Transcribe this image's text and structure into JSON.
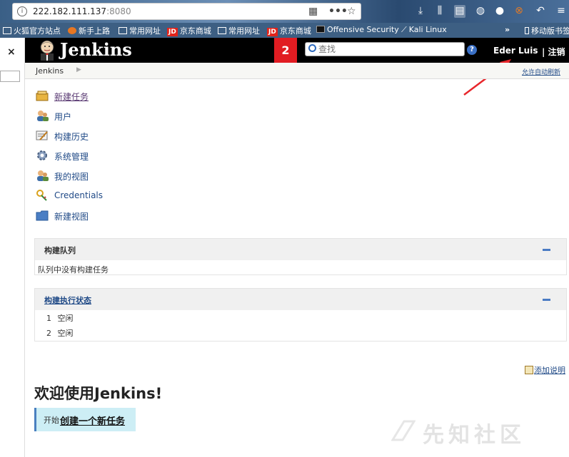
{
  "browser": {
    "url_host": "222.182.111.137",
    "url_port": ":8080",
    "bookmarks": [
      "火狐官方站点",
      "新手上路",
      "常用网址",
      "京东商城",
      "常用网址",
      "京东商城",
      "Offensive Security",
      "Kali Linux",
      "移动版书签"
    ],
    "jd_badge": "JD"
  },
  "sidebar": {
    "close_label": "×"
  },
  "header": {
    "title": "Jenkins",
    "notification_count": "2",
    "search_placeholder": "查找",
    "help_label": "?",
    "user_name": "Eder Luis",
    "logout_label": "| 注销"
  },
  "breadcrumb": {
    "root": "Jenkins",
    "auto_refresh": "允许自动刷新"
  },
  "tasks": [
    {
      "label": "新建任务",
      "icon": "new-item-icon"
    },
    {
      "label": "用户",
      "icon": "users-icon"
    },
    {
      "label": "构建历史",
      "icon": "build-history-icon"
    },
    {
      "label": "系统管理",
      "icon": "gear-icon"
    },
    {
      "label": "我的视图",
      "icon": "my-views-icon"
    },
    {
      "label": "Credentials",
      "icon": "credentials-icon"
    },
    {
      "label": "新建视图",
      "icon": "folder-icon"
    }
  ],
  "build_queue": {
    "title": "构建队列",
    "empty_message": "队列中没有构建任务"
  },
  "executors": {
    "title": "构建执行状态",
    "rows": [
      {
        "index": "1",
        "status": "空闲"
      },
      {
        "index": "2",
        "status": "空闲"
      }
    ]
  },
  "main": {
    "add_description": "添加说明",
    "welcome": "欢迎使用Jenkins!",
    "start_prefix": "开始",
    "start_link": "创建一个新任务"
  },
  "watermark": {
    "text": "先知社区"
  },
  "colors": {
    "header_bg": "#000000",
    "notification_bg": "#e11c22",
    "link": "#204a87",
    "start_box_bg": "#cdeef5",
    "annotation_arrow": "#e8262b"
  }
}
